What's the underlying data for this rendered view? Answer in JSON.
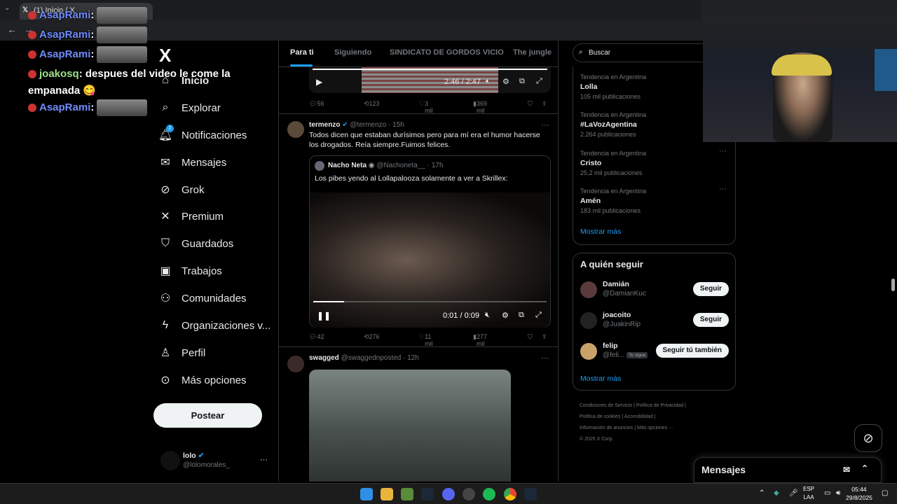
{
  "browser": {
    "tab_title": "(1) Inicio / X"
  },
  "chat": [
    {
      "user": "AsapRami",
      "sep": ":",
      "msg": ""
    },
    {
      "user": "AsapRami",
      "sep": ":",
      "msg": ""
    },
    {
      "user": "AsapRami",
      "sep": ":",
      "msg": ""
    },
    {
      "user": "joakosq",
      "sep": ":",
      "msg": " despues del video le come la"
    },
    {
      "user": "",
      "sep": "",
      "msg": "empanada"
    },
    {
      "user": "AsapRami",
      "sep": ":",
      "msg": ""
    }
  ],
  "nav": {
    "logo": "X",
    "items": [
      {
        "label": "Inicio",
        "icon": "home-icon"
      },
      {
        "label": "Explorar",
        "icon": "search-icon"
      },
      {
        "label": "Notificaciones",
        "icon": "bell-icon",
        "badge": "2"
      },
      {
        "label": "Mensajes",
        "icon": "mail-icon"
      },
      {
        "label": "Grok",
        "icon": "grok-icon"
      },
      {
        "label": "Premium",
        "icon": "x-icon"
      },
      {
        "label": "Guardados",
        "icon": "bookmark-icon"
      },
      {
        "label": "Trabajos",
        "icon": "briefcase-icon"
      },
      {
        "label": "Comunidades",
        "icon": "people-icon"
      },
      {
        "label": "Organizaciones v...",
        "icon": "lightning-icon"
      },
      {
        "label": "Perfil",
        "icon": "person-icon"
      },
      {
        "label": "Más opciones",
        "icon": "more-circle-icon"
      }
    ],
    "post_button": "Postear",
    "profile": {
      "name": "lolo",
      "handle": "@lolomorales_",
      "more": "···"
    }
  },
  "feed": {
    "tabs": [
      "Para ti",
      "Siguiendo",
      "SINDICATO DE GORDOS VICIO",
      "The jungle"
    ],
    "video1": {
      "time": "2:46 / 2:47"
    },
    "actions1": {
      "replies": "56",
      "reposts": "123",
      "likes": "3 mil",
      "views": "369 mil"
    },
    "tweet2": {
      "name": "termenzo",
      "handle": "@termenzo",
      "time": "· 15h",
      "text": "Todos dicen que estaban durísimos pero para mí era el humor hacerse los drogados. Reía siempre.Fuimos felices.",
      "quote": {
        "name": "Nacho Neta",
        "handle": "@Nachoneta__",
        "time": "· 17h",
        "text": "Los pibes yendo al Lollapalooza solamente a ver a Skrillex:",
        "video_time": "0:01 / 0:09"
      },
      "actions": {
        "replies": "42",
        "reposts": "276",
        "likes": "11 mil",
        "views": "277 mil"
      }
    },
    "tweet3": {
      "name": "swagged",
      "handle": "@swaggednposted",
      "time": "· 12h"
    }
  },
  "sidebar": {
    "search_placeholder": "Buscar",
    "trends": [
      {
        "context": "Tendencia en Argentina",
        "name": "Lolla",
        "count": "105 mil publicaciones"
      },
      {
        "context": "Tendencia en Argentina",
        "name": "#LaVozAgentina",
        "count": "2.264 publicaciones"
      },
      {
        "context": "Tendencia en Argentina",
        "name": "Cristo",
        "count": "25,2 mil publicaciones"
      },
      {
        "context": "Tendencia en Argentina",
        "name": "Amén",
        "count": "183 mil publicaciones"
      }
    ],
    "trends_show_more": "Mostrar más",
    "who_to_follow_title": "A quién seguir",
    "follow": [
      {
        "name": "Damián",
        "handle": "@DamianKuc",
        "button": "Seguir"
      },
      {
        "name": "joacoito",
        "handle": "@JuakinRip",
        "button": "Seguir"
      },
      {
        "name": "felip",
        "handle": "@feli...",
        "tag": "Te sigue",
        "button": "Seguir tú también"
      }
    ],
    "follow_show_more": "Mostrar más",
    "footer": [
      "Condiciones de Servicio",
      "Política de Privacidad",
      "Política de cookies",
      "Accesibilidad",
      "Información de anuncios",
      "Más opciones ···",
      "© 2025 X Corp."
    ]
  },
  "messages_drawer": {
    "title": "Mensajes"
  },
  "taskbar": {
    "lang": "ESP",
    "lang2": "LAA",
    "time": "05:44",
    "date": "29/8/2025"
  },
  "colors": {
    "accent": "#1d9bf0",
    "bg": "#000000",
    "border": "#2f3336"
  }
}
